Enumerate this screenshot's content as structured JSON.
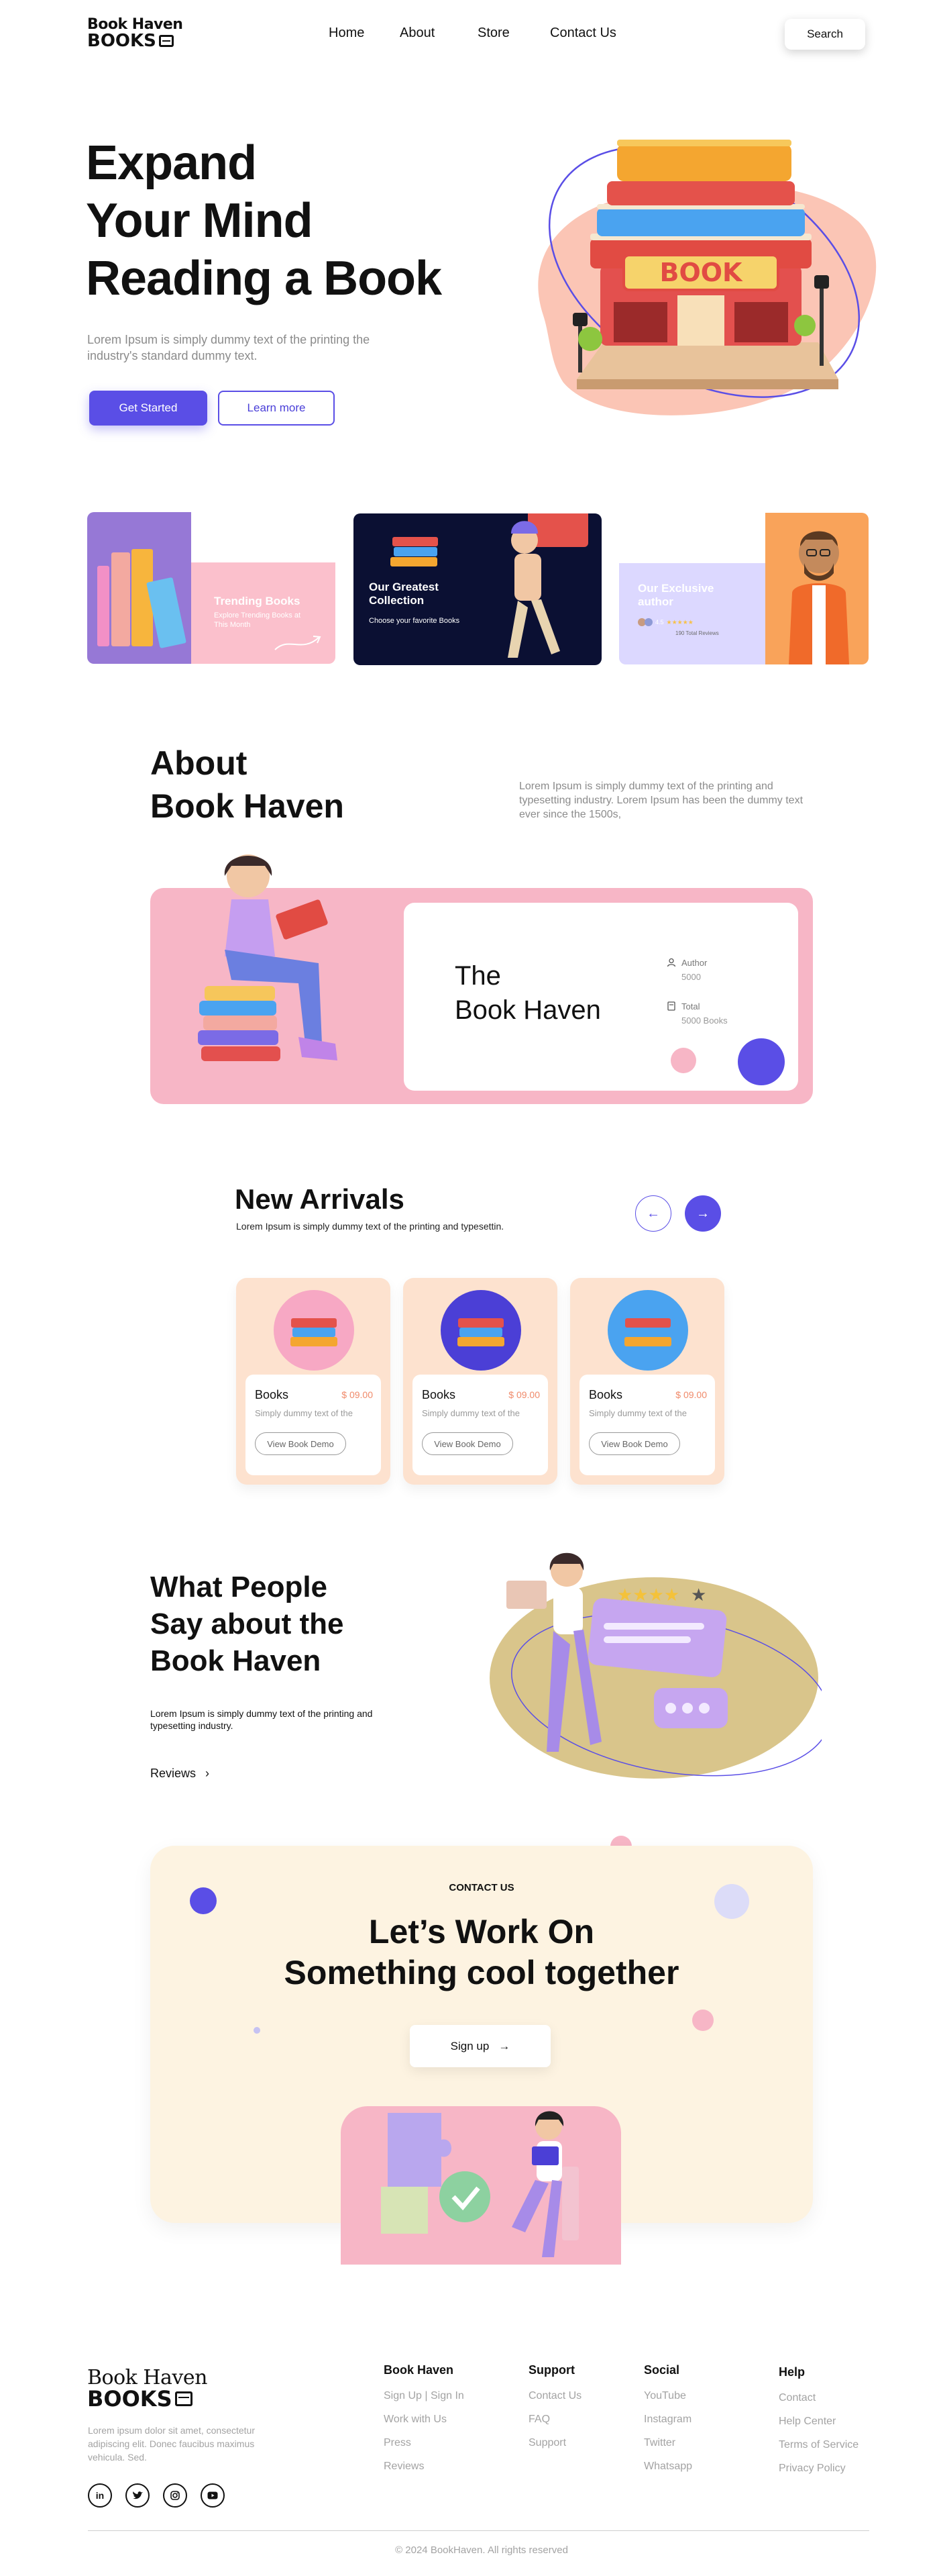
{
  "nav": {
    "logo_line1": "Book Haven",
    "logo_line2": "BOOKS",
    "links": [
      "Home",
      "About",
      "Store",
      "Contact Us"
    ],
    "search_label": "Search"
  },
  "hero": {
    "title_lines": [
      "Expand",
      "Your Mind",
      "Reading a Book"
    ],
    "subtitle": "Lorem Ipsum is simply dummy text of the printing the industry's standard dummy text.",
    "primary_cta": "Get Started",
    "secondary_cta": "Learn more",
    "sign_text": "BOOK"
  },
  "features": [
    {
      "title": "Trending Books",
      "subtitle": "Explore Trending Books at This Month"
    },
    {
      "title": "Our Greatest Collection",
      "subtitle": "Choose your favorite Books"
    },
    {
      "title": "Our Exclusive author",
      "rating_label": "4.5",
      "reviews": "190 Total Reviews"
    }
  ],
  "about": {
    "title_lines": [
      "About",
      "Book Haven"
    ],
    "text": "Lorem Ipsum is simply dummy text of the printing and typesetting industry. Lorem Ipsum has been the dummy text ever since the 1500s,",
    "card_title_lines": [
      "The",
      "Book Haven"
    ],
    "stats": [
      {
        "label": "Author",
        "value": "5000"
      },
      {
        "label": "Total",
        "value": "5000 Books"
      }
    ]
  },
  "arrivals": {
    "title": "New Arrivals",
    "subtitle": "Lorem Ipsum is simply dummy text of the printing and typesettin.",
    "items": [
      {
        "name": "Books",
        "price": "$ 09.00",
        "desc": "Simply dummy text of the",
        "cta": "View Book Demo",
        "circle": "#f7a8c4"
      },
      {
        "name": "Books",
        "price": "$ 09.00",
        "desc": "Simply dummy text of the",
        "cta": "View Book Demo",
        "circle": "#4b3fd6"
      },
      {
        "name": "Books",
        "price": "$ 09.00",
        "desc": "Simply dummy text of the",
        "cta": "View Book Demo",
        "circle": "#4aa3f0"
      }
    ]
  },
  "testimonials": {
    "title_lines": [
      "What People",
      "Say about the",
      "Book Haven"
    ],
    "text": "Lorem Ipsum is simply dummy text of the printing and typesetting industry.",
    "link": "Reviews"
  },
  "contact": {
    "eyebrow": "CONTACT US",
    "title_lines": [
      "Let’s Work On",
      "Something cool together"
    ],
    "cta": "Sign up"
  },
  "footer": {
    "logo_line1": "Book Haven",
    "logo_line2": "BOOKS",
    "about": "Lorem ipsum dolor sit amet, consectetur adipiscing elit. Donec faucibus maximus vehicula. Sed.",
    "social": [
      "in",
      "tw",
      "ig",
      "yt"
    ],
    "columns": [
      {
        "title": "Book Haven",
        "links": [
          "Sign Up | Sign In",
          "Work with Us",
          "Press",
          "Reviews"
        ]
      },
      {
        "title": "Support",
        "links": [
          "Contact Us",
          "FAQ",
          "Support"
        ]
      },
      {
        "title": "Social",
        "links": [
          "YouTube",
          "Instagram",
          "Twitter",
          "Whatsapp"
        ]
      },
      {
        "title": "Help",
        "links": [
          "Contact",
          "Help Center",
          "Terms of Service",
          "Privacy Policy"
        ]
      }
    ],
    "copyright": "© 2024 BookHaven. All rights reserved"
  },
  "colors": {
    "accent": "#5a4ee6",
    "pink": "#f7b6c6",
    "navy": "#0b1033",
    "peach": "#fde2cf",
    "cream": "#fdf3e1",
    "olive": "#d9c58b"
  }
}
